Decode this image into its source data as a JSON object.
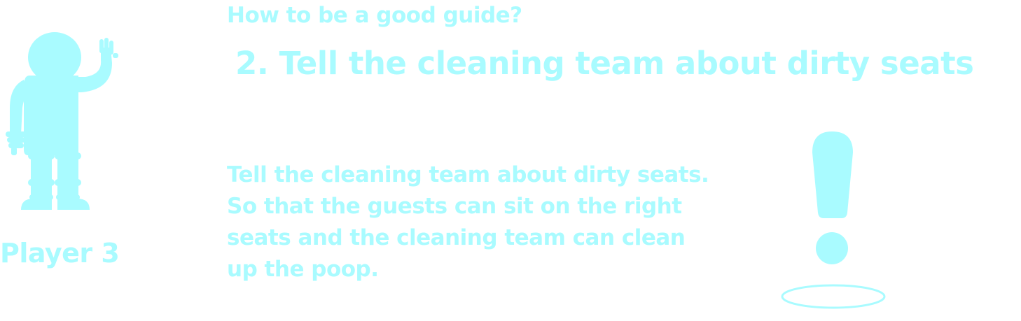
{
  "player": {
    "label": "Player 3",
    "icon": "waving-person-icon"
  },
  "guide": {
    "kicker": "How to be a good guide?",
    "step_title": "2. Tell the cleaning team about dirty seats",
    "body_lines": [
      "Tell the cleaning team about dirty seats.",
      "So that the guests can sit on the right",
      "seats and the cleaning team can clean",
      "up the poop."
    ]
  },
  "alert": {
    "icon": "exclamation-mark-icon"
  },
  "colors": {
    "accent": "#a9fbff",
    "background": "#ffffff"
  }
}
